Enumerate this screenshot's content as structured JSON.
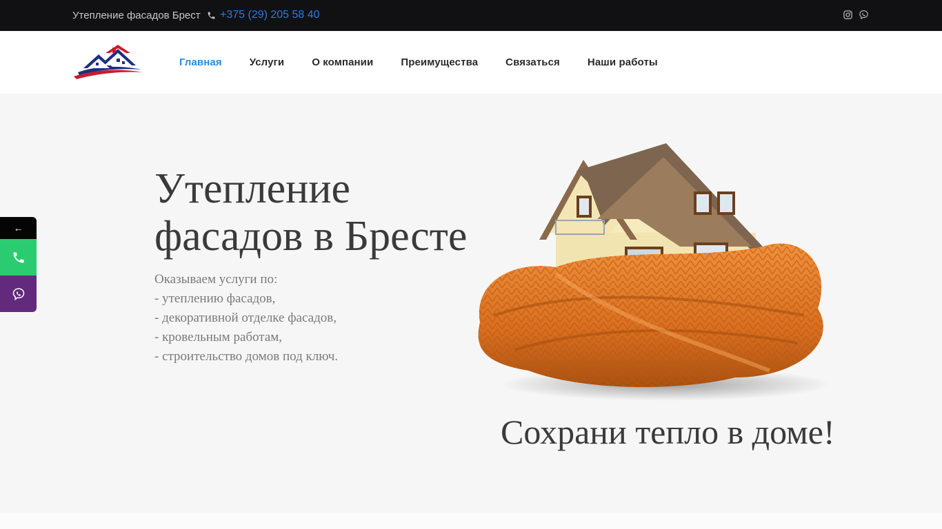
{
  "topbar": {
    "site_name": "Утепление фасадов Брест",
    "phone": "+375 (29) 205 58 40",
    "phone_icon": "phone-icon",
    "social": [
      "instagram-icon",
      "viber-icon"
    ]
  },
  "nav": {
    "items": [
      {
        "label": "Главная",
        "active": true
      },
      {
        "label": "Услуги"
      },
      {
        "label": "О компании"
      },
      {
        "label": "Преимущества"
      },
      {
        "label": "Связаться"
      },
      {
        "label": "Наши работы"
      }
    ]
  },
  "hero": {
    "title_line1": "Утепление",
    "title_line2": "фасадов в Бресте",
    "intro": "Оказываем услуги по:",
    "services": [
      "- утеплению фасадов,",
      "- декоративной отделке фасадов,",
      "- кровельным работам,",
      "- строительство домов под ключ."
    ],
    "slogan": "Сохрани тепло в доме!"
  },
  "side_panel": {
    "collapse_label": "←",
    "call_icon": "phone-icon",
    "viber_icon": "viber-icon"
  },
  "colors": {
    "topbar_bg": "#111114",
    "accent_link": "#2a8bd6",
    "call_green": "#2bcc71",
    "viber_purple": "#62297d",
    "scarf_orange": "#e07a26"
  }
}
